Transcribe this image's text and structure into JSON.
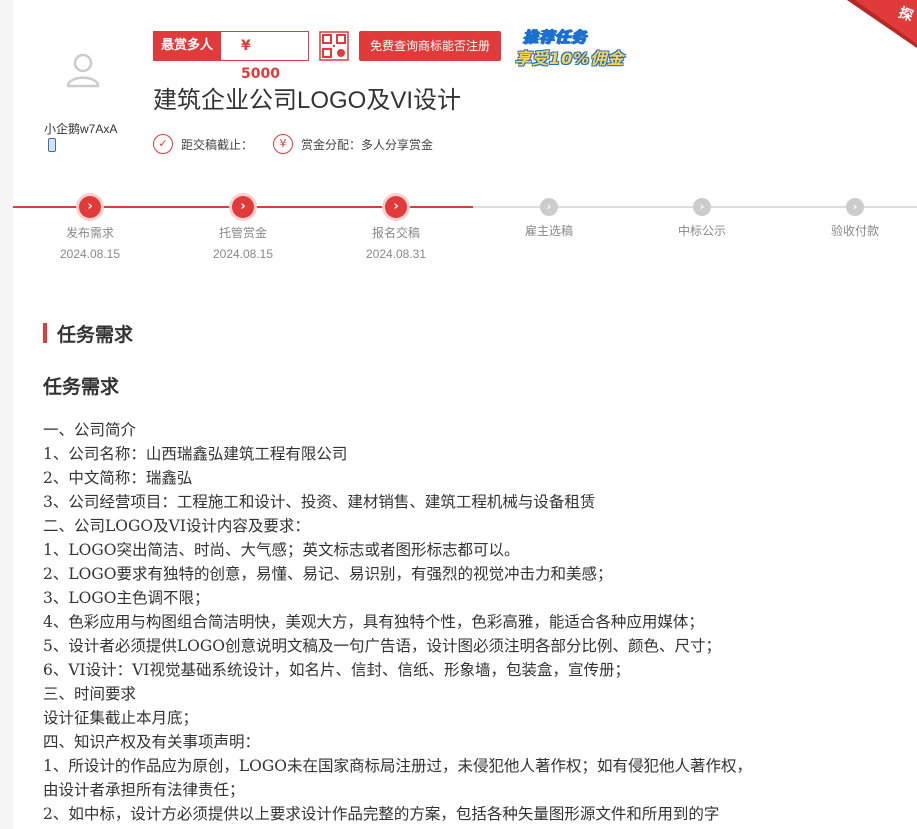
{
  "user": {
    "name": "小企鹅w7AxA"
  },
  "reward": {
    "label": "悬赏多人",
    "amount": "¥ 5000"
  },
  "trademark_button": "免费查询商标能否注册",
  "promo": {
    "line1": "推荐任务",
    "line2": "享受10%佣金"
  },
  "corner_ribbon": "探",
  "task": {
    "title": "建筑企业公司LOGO及VI设计"
  },
  "meta": {
    "deadline_label": "距交稿截止：",
    "deadline_icon": "✓",
    "distribution_label": "赏金分配：多人分享赏金",
    "distribution_icon": "¥"
  },
  "progress": {
    "steps": [
      {
        "label": "发布需求",
        "date": "2024.08.15",
        "status": "done"
      },
      {
        "label": "托管赏金",
        "date": "2024.08.15",
        "status": "done"
      },
      {
        "label": "报名交稿",
        "date": "2024.08.31",
        "status": "done"
      },
      {
        "label": "雇主选稿",
        "date": "",
        "status": "todo"
      },
      {
        "label": "中标公示",
        "date": "",
        "status": "todo"
      },
      {
        "label": "验收付款",
        "date": "",
        "status": "todo"
      }
    ]
  },
  "section": {
    "heading": "任务需求",
    "content_title": "任务需求"
  },
  "content_lines": [
    "一、公司简介",
    "1、公司名称：山西瑞鑫弘建筑工程有限公司",
    "2、中文简称：瑞鑫弘",
    "3、公司经营项目：工程施工和设计、投资、建材销售、建筑工程机械与设备租赁",
    "二、公司LOGO及VI设计内容及要求：",
    "1、LOGO突出简洁、时尚、大气感；英文标志或者图形标志都可以。",
    "2、LOGO要求有独特的创意，易懂、易记、易识别，有强烈的视觉冲击力和美感；",
    "3、LOGO主色调不限；",
    "4、色彩应用与构图组合简洁明快，美观大方，具有独特个性，色彩高雅，能适合各种应用媒体；",
    "5、设计者必须提供LOGO创意说明文稿及一句广告语，设计图必须注明各部分比例、颜色、尺寸；",
    "6、VI设计：VI视觉基础系统设计，如名片、信封、信纸、形象墙，包装盒，宣传册；",
    "三、时间要求",
    "设计征集截止本月底；",
    "四、知识产权及有关事项声明：",
    "1、所设计的作品应为原创，LOGO未在国家商标局注册过，未侵犯他人著作权；如有侵犯他人著作权，",
    "由设计者承担所有法律责任；",
    "2、如中标，设计方必须提供以上要求设计作品完整的方案，包括各种矢量图形源文件和所用到的字"
  ],
  "colors": {
    "accent": "#e03a3a",
    "inactive": "#cccccc"
  }
}
